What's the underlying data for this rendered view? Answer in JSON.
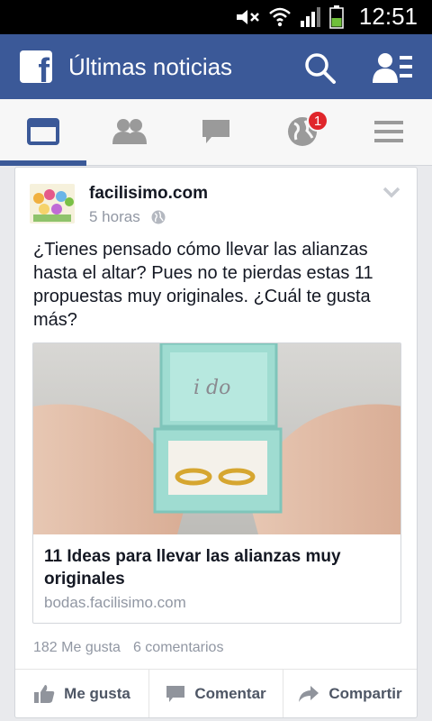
{
  "status_bar": {
    "time": "12:51",
    "icons": [
      "mute-icon",
      "wifi-icon",
      "signal-icon",
      "battery-icon"
    ]
  },
  "app_bar": {
    "logo": "f",
    "title": "Últimas noticias",
    "actions": [
      "search-icon",
      "friend-requests-icon"
    ]
  },
  "tabs": [
    {
      "name": "news-feed",
      "icon": "news-feed-icon",
      "active": true
    },
    {
      "name": "friends",
      "icon": "friends-icon",
      "active": false
    },
    {
      "name": "messages",
      "icon": "chat-icon",
      "active": false
    },
    {
      "name": "notifications",
      "icon": "globe-icon",
      "active": false,
      "badge": "1"
    },
    {
      "name": "more",
      "icon": "menu-icon",
      "active": false
    }
  ],
  "post": {
    "page_name": "facilisimo.com",
    "time": "5 horas",
    "privacy_icon": "globe-icon",
    "text": "¿Tienes pensado cómo llevar las alianzas hasta el altar? Pues no te pierdas estas 11 propuestas muy originales. ¿Cuál te gusta más?",
    "link": {
      "image_caption": "i do",
      "title": "11 Ideas para llevar las alianzas muy originales",
      "domain": "bodas.facilisimo.com"
    },
    "likes": "182 Me gusta",
    "comments": "6 comentarios",
    "actions": {
      "like": "Me gusta",
      "comment": "Comentar",
      "share": "Compartir"
    }
  },
  "colors": {
    "brand": "#3b5998",
    "badge": "#e0262b",
    "muted_text": "#9197a3",
    "feed_bg": "#e9eaed"
  }
}
